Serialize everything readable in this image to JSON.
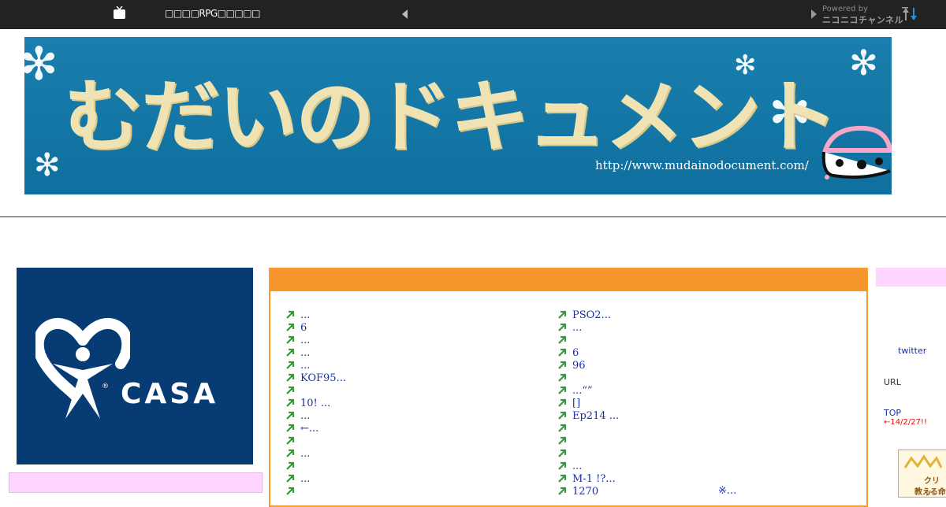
{
  "topbar": {
    "title": "□□□□RPG□□□□□",
    "powered_by": "Powered by",
    "network": "ニコニコチャンネル"
  },
  "banner": {
    "title": "むだいのドキュメント",
    "url": "http://www.mudainodocument.com/"
  },
  "ad_left": {
    "brand": "CASA",
    "reg_mark": "®"
  },
  "main": {
    "left_items": [
      "...",
      "6",
      " ...",
      "...",
      "...",
      "KOF95...",
      "",
      "10! ...",
      "...",
      "←...",
      "",
      " ...",
      "",
      "...",
      ""
    ],
    "right_items": [
      "PSO2...",
      "...",
      "",
      "6",
      " 96",
      "",
      " ...“”",
      " []",
      "Ep214 ...",
      "",
      "",
      "",
      "...",
      "M-1  !?...",
      "1270"
    ],
    "right_extra": "※..."
  },
  "sidebar": {
    "twitter": "twitter",
    "url_label": "URL",
    "top_label": "TOP",
    "date_note": "←14/2/27!!",
    "badge_line1": "クリッ",
    "badge_line2": "教える命"
  },
  "colors": {
    "topbar_bg": "#222222",
    "banner_bg": "#1a7fae",
    "accent_orange": "#f7962c",
    "link_blue": "#1a2ea8",
    "pink": "#ffd6ff",
    "casa_blue": "#073b74",
    "arrow_green": "#3a9a3a"
  }
}
